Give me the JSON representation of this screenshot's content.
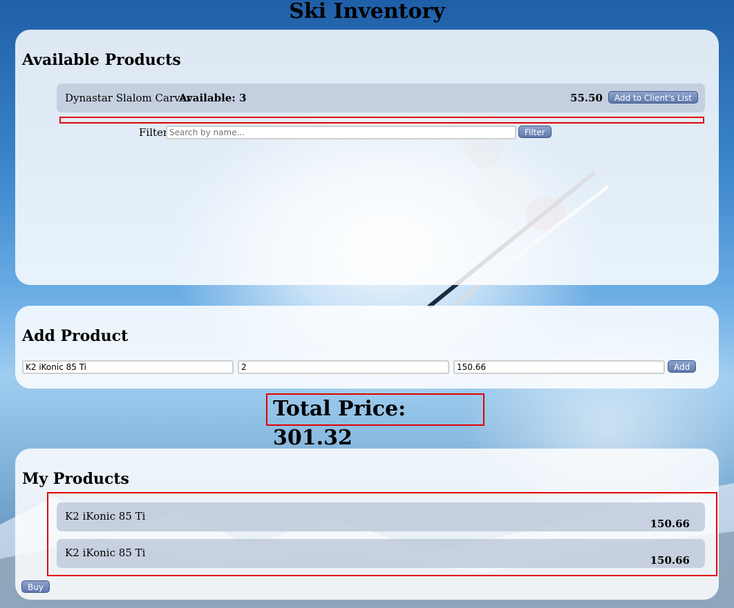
{
  "page_title": "Ski Inventory",
  "available": {
    "heading": "Available Products",
    "items": [
      {
        "name": "Dynastar Slalom Carver",
        "available_text": "Available: 3",
        "price": "55.50",
        "action_label": "Add to Client's List"
      }
    ],
    "filter": {
      "label": "Filter",
      "placeholder": "Search by name...",
      "button_label": "Filter"
    }
  },
  "add_product": {
    "heading": "Add Product",
    "name_value": "K2 iKonic 85 Ti",
    "quantity_value": "2",
    "price_value": "150.66",
    "button_label": "Add"
  },
  "total": {
    "text": "Total Price: 301.32"
  },
  "my_products": {
    "heading": "My Products",
    "items": [
      {
        "name": "K2 iKonic 85 Ti",
        "price": "150.66"
      },
      {
        "name": "K2 iKonic 85 Ti",
        "price": "150.66"
      }
    ],
    "buy_label": "Buy"
  },
  "colors": {
    "highlight_border": "#e00000",
    "button": "#6f87b9",
    "row_background": "#c3cedb"
  }
}
